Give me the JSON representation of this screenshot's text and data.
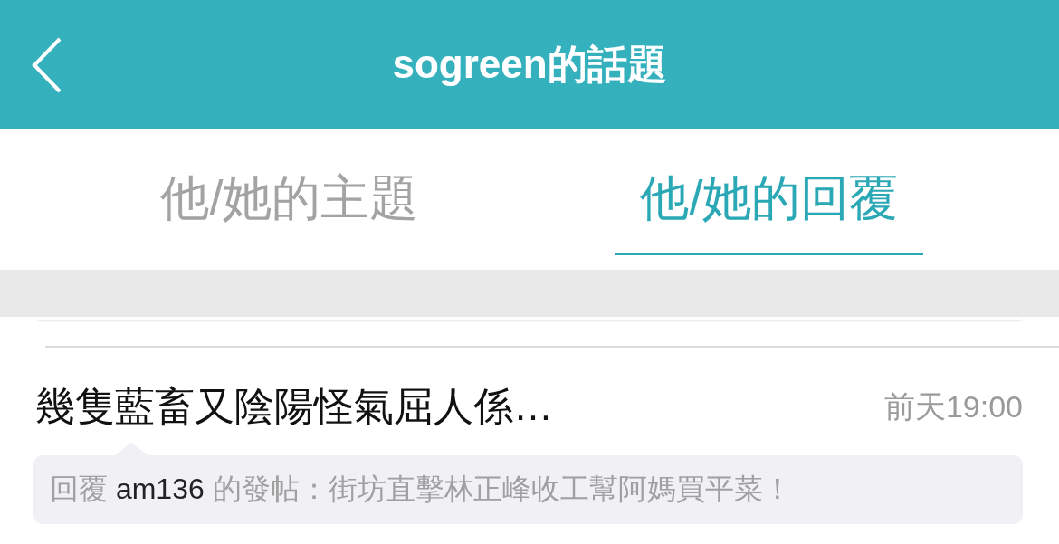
{
  "header": {
    "title": "sogreen的話題"
  },
  "tabs": [
    {
      "label": "他/她的主題",
      "selected": false
    },
    {
      "label": "他/她的回覆",
      "selected": true
    }
  ],
  "posts": [
    {
      "title": "幾隻藍畜又陰陽怪氣屈人係…",
      "time": "前天19:00",
      "quote": {
        "prefix": "回覆 ",
        "user": "am136",
        "suffix": " 的發帖：街坊直擊林正峰收工幫阿媽買平菜！"
      }
    }
  ]
}
